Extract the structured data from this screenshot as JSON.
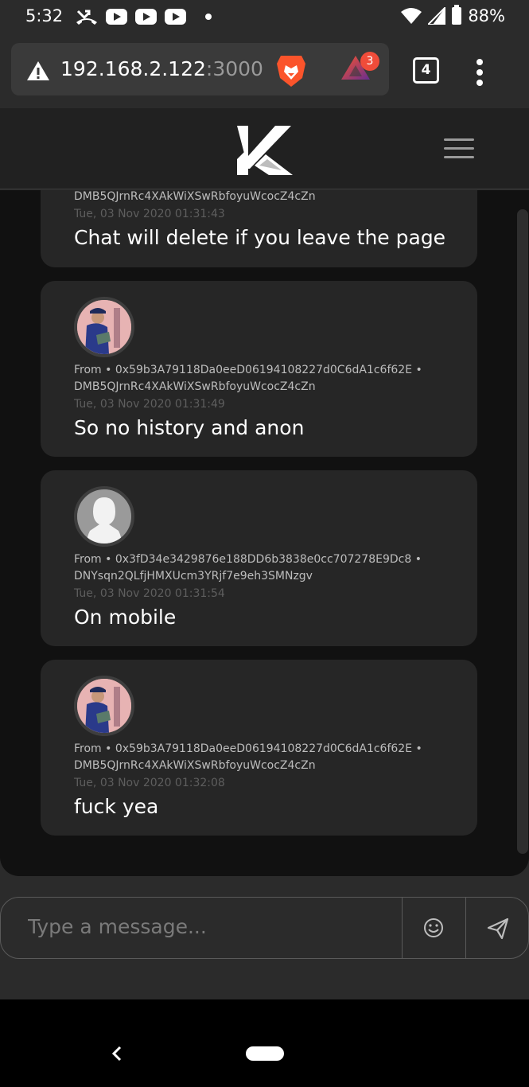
{
  "status_bar": {
    "time": "5:32",
    "battery": "88%",
    "icons": [
      "missed-call-icon",
      "youtube-icon",
      "youtube-icon",
      "youtube-icon",
      "dot-icon",
      "wifi-icon",
      "signal-icon",
      "battery-icon"
    ]
  },
  "browser": {
    "url_host": "192.168.2.122",
    "url_port": ":3000/",
    "rewards_count": "3",
    "tab_count": "4",
    "icons": [
      "warning-icon",
      "brave-lion-icon",
      "brave-rewards-icon",
      "tabs-icon",
      "more-vert-icon"
    ]
  },
  "header": {
    "logo": "K",
    "menu_icon": "hamburger-icon"
  },
  "messages": [
    {
      "from_line": "",
      "wallet": "DMB5QJrnRc4XAkWiXSwRbfoyuWcocZ4cZn",
      "time": "Tue, 03 Nov 2020 01:31:43",
      "text": "Chat will delete if you leave the page"
    },
    {
      "from_line": "From • 0x59b3A79118Da0eeD06194108227d0C6dA1c6f62E •",
      "wallet": "DMB5QJrnRc4XAkWiXSwRbfoyuWcocZ4cZn",
      "time": "Tue, 03 Nov 2020 01:31:49",
      "text": "So no history and anon"
    },
    {
      "from_line": "From • 0x3fD34e3429876e188DD6b3838e0cc707278E9Dc8 •",
      "wallet": "DNYsqn2QLfjHMXUcm3YRjf7e9eh3SMNzgv",
      "time": "Tue, 03 Nov 2020 01:31:54",
      "text": "On mobile"
    },
    {
      "from_line": "From • 0x59b3A79118Da0eeD06194108227d0C6dA1c6f62E •",
      "wallet": "DMB5QJrnRc4XAkWiXSwRbfoyuWcocZ4cZn",
      "time": "Tue, 03 Nov 2020 01:32:08",
      "text": "fuck yea"
    }
  ],
  "composer": {
    "placeholder": "Type a message..."
  },
  "colors": {
    "background": "#2b2b2b",
    "chat_bg": "#111111",
    "card_bg": "#262626",
    "header_bg": "#212121",
    "badge": "#f04c3a",
    "brave_orange": "#fb542b"
  }
}
